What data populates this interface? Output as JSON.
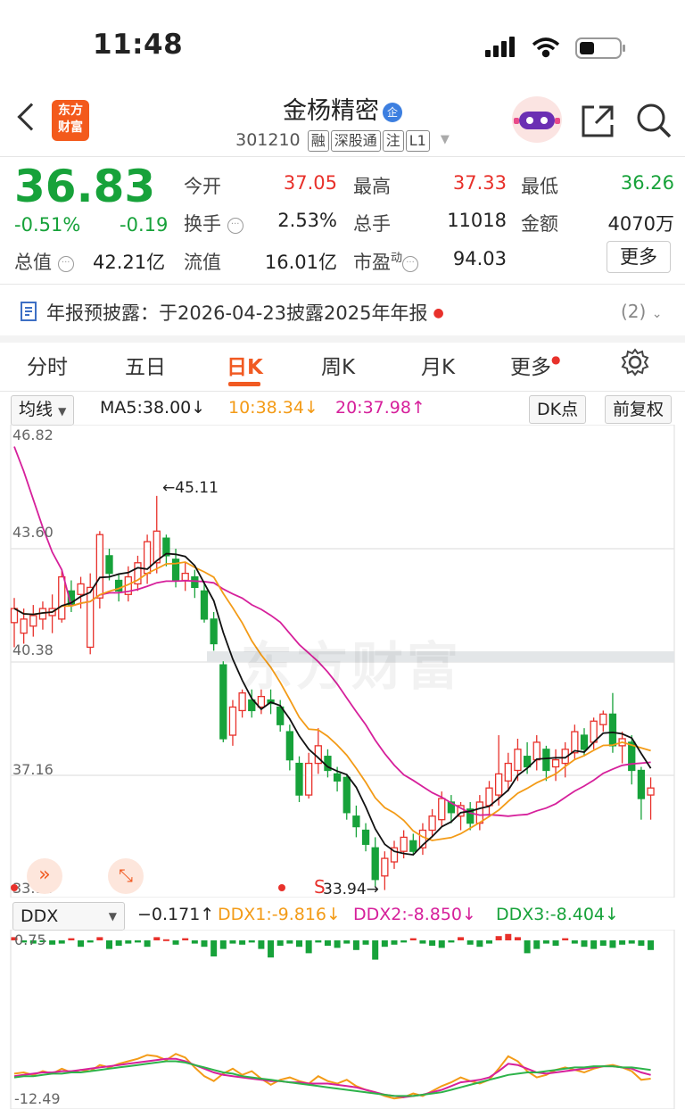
{
  "status": {
    "time": "11:48"
  },
  "header": {
    "logo_line1": "东方",
    "logo_line2": "财富",
    "stock_name": "金杨精密",
    "qi_badge": "企",
    "code": "301210",
    "tags": [
      "融",
      "深股通",
      "注",
      "L1"
    ]
  },
  "quote": {
    "price": "36.83",
    "change_pct": "-0.51%",
    "change": "-0.19",
    "cap_label": "总值",
    "cap_value": "42.21亿",
    "rows": [
      [
        {
          "label": "今开",
          "value": "37.05",
          "color": "red"
        },
        {
          "label": "最高",
          "value": "37.33",
          "color": "red"
        },
        {
          "label": "最低",
          "value": "36.26",
          "color": "green"
        }
      ],
      [
        {
          "label": "换手",
          "value": "2.53%",
          "color": "black"
        },
        {
          "label": "总手",
          "value": "11018",
          "color": "black"
        },
        {
          "label": "金额",
          "value": "4070万",
          "color": "black"
        }
      ],
      [
        {
          "label": "流值",
          "value": "16.01亿",
          "color": "black"
        },
        {
          "label": "市盈",
          "sup": "动",
          "value": "94.03",
          "color": "black"
        }
      ]
    ],
    "more_label": "更多"
  },
  "notice": {
    "text": "年报预披露：于2026-04-23披露2025年年报",
    "count": "(2)"
  },
  "tabs": [
    "分时",
    "五日",
    "日K",
    "周K",
    "月K",
    "更多"
  ],
  "active_tab": "日K",
  "indicators": {
    "ma_select": "均线",
    "ma5": "MA5:38.00",
    "ma10": "10:38.34",
    "ma20": "20:37.98",
    "dk_label": "DK点",
    "adjust_label": "前复权"
  },
  "kchart": {
    "y_labels": [
      "46.82",
      "43.60",
      "40.38",
      "37.16",
      "33.94"
    ],
    "high_label": "45.11",
    "low_label": "33.94",
    "s_marker": "S",
    "watermark": "东方财富"
  },
  "ddx": {
    "select": "DDX",
    "ddx_val": "−0.171",
    "ddx1": "DDX1:-9.816",
    "ddx2": "DDX2:-8.850",
    "ddx3": "DDX3:-8.404",
    "y_top": "0.75",
    "y_bottom": "-12.49"
  },
  "colors": {
    "up": "#e8312b",
    "down": "#17a23a",
    "accent": "#f15a22",
    "ma5": "#111111",
    "ma10": "#f39b17",
    "ma20": "#d6209b"
  },
  "candles": [
    [
      41.5,
      41.9,
      40.8,
      42.2
    ],
    [
      41.2,
      41.6,
      40.9,
      41.9
    ],
    [
      41.4,
      41.7,
      41.1,
      42.0
    ],
    [
      41.6,
      41.9,
      41.3,
      42.1
    ],
    [
      41.7,
      41.9,
      41.2,
      42.3
    ],
    [
      41.6,
      42.8,
      41.5,
      43.0
    ],
    [
      42.4,
      42.0,
      41.8,
      42.7
    ],
    [
      42.3,
      42.6,
      41.9,
      42.8
    ],
    [
      40.8,
      42.5,
      40.6,
      42.9
    ],
    [
      42.2,
      44.0,
      41.9,
      44.1
    ],
    [
      43.4,
      42.9,
      42.7,
      43.6
    ],
    [
      42.7,
      42.4,
      42.1,
      42.9
    ],
    [
      42.3,
      42.8,
      42.1,
      43.1
    ],
    [
      42.6,
      43.2,
      42.4,
      43.4
    ],
    [
      42.9,
      43.8,
      42.6,
      44.0
    ],
    [
      43.2,
      44.1,
      42.9,
      45.1
    ],
    [
      43.9,
      43.4,
      43.1,
      44.0
    ],
    [
      43.3,
      42.7,
      42.5,
      43.6
    ],
    [
      42.7,
      42.9,
      42.4,
      43.2
    ],
    [
      42.8,
      42.5,
      42.2,
      43.0
    ],
    [
      42.4,
      41.6,
      41.5,
      42.6
    ],
    [
      41.6,
      40.9,
      40.7,
      41.8
    ],
    [
      40.3,
      38.2,
      38.1,
      40.4
    ],
    [
      38.3,
      39.1,
      38.0,
      39.3
    ],
    [
      39.0,
      39.5,
      38.8,
      39.6
    ],
    [
      39.3,
      39.0,
      38.8,
      39.6
    ],
    [
      39.1,
      39.4,
      38.9,
      39.6
    ],
    [
      39.3,
      39.2,
      38.9,
      39.6
    ],
    [
      39.1,
      38.6,
      38.4,
      39.3
    ],
    [
      38.4,
      37.6,
      37.3,
      38.6
    ],
    [
      37.5,
      36.6,
      36.4,
      37.7
    ],
    [
      36.6,
      37.5,
      36.5,
      37.8
    ],
    [
      37.5,
      38.0,
      37.2,
      38.5
    ],
    [
      37.7,
      37.3,
      37.1,
      37.9
    ],
    [
      37.2,
      37.0,
      36.7,
      37.4
    ],
    [
      37.1,
      36.1,
      35.9,
      37.2
    ],
    [
      36.0,
      35.7,
      35.4,
      36.3
    ],
    [
      35.6,
      35.2,
      35.0,
      35.8
    ],
    [
      35.1,
      34.2,
      34.0,
      35.4
    ],
    [
      34.3,
      34.8,
      33.9,
      35.0
    ],
    [
      34.7,
      35.1,
      34.5,
      35.3
    ],
    [
      35.0,
      35.4,
      34.8,
      35.6
    ],
    [
      35.3,
      35.0,
      34.9,
      35.5
    ],
    [
      35.1,
      35.6,
      34.9,
      35.8
    ],
    [
      35.6,
      36.0,
      35.4,
      36.2
    ],
    [
      35.9,
      36.5,
      35.7,
      36.7
    ],
    [
      36.4,
      36.1,
      35.8,
      36.6
    ],
    [
      36.0,
      36.3,
      35.6,
      36.4
    ],
    [
      36.2,
      35.8,
      35.6,
      36.4
    ],
    [
      35.8,
      36.4,
      35.6,
      36.6
    ],
    [
      36.3,
      36.8,
      36.0,
      37.0
    ],
    [
      36.6,
      37.2,
      36.3,
      38.3
    ],
    [
      37.0,
      37.5,
      36.7,
      37.8
    ],
    [
      37.3,
      37.9,
      37.0,
      38.2
    ],
    [
      37.7,
      37.4,
      37.2,
      38.1
    ],
    [
      37.6,
      38.1,
      37.3,
      38.3
    ],
    [
      37.9,
      37.3,
      37.0,
      38.0
    ],
    [
      37.4,
      37.6,
      37.0,
      37.9
    ],
    [
      37.5,
      37.9,
      37.1,
      38.1
    ],
    [
      37.8,
      38.4,
      37.6,
      38.6
    ],
    [
      38.3,
      37.9,
      37.7,
      38.5
    ],
    [
      38.1,
      38.7,
      37.9,
      38.8
    ],
    [
      38.6,
      38.9,
      38.4,
      39.0
    ],
    [
      38.9,
      38.0,
      37.8,
      39.5
    ],
    [
      38.0,
      38.2,
      37.5,
      38.4
    ],
    [
      38.1,
      37.3,
      36.9,
      38.3
    ],
    [
      37.3,
      36.5,
      35.9,
      37.4
    ],
    [
      36.6,
      36.8,
      35.9,
      37.1
    ]
  ],
  "chart_data": {
    "type": "candlestick",
    "ylim": [
      33.94,
      46.82
    ],
    "y_ticks": [
      46.82,
      43.6,
      40.38,
      37.16,
      33.94
    ],
    "annotations": {
      "high": 45.11,
      "low": 33.94
    },
    "series": [
      {
        "name": "MA5",
        "last": 38.0
      },
      {
        "name": "MA10",
        "last": 38.34
      },
      {
        "name": "MA20",
        "last": 37.98
      }
    ]
  },
  "ddx_bars": [
    0.3,
    -0.2,
    -0.3,
    -0.1,
    -0.4,
    -0.3,
    0.2,
    -0.6,
    -0.2,
    0.3,
    -0.8,
    -0.5,
    -0.3,
    -0.2,
    -0.6,
    0.3,
    0.1,
    -0.4,
    0.2,
    -0.3,
    -0.6,
    -1.5,
    -0.8,
    -0.3,
    -0.4,
    -0.2,
    -0.8,
    -1.6,
    -0.5,
    -0.3,
    -0.6,
    -1.2,
    -0.2,
    -0.5,
    -0.7,
    -0.3,
    -0.9,
    -0.4,
    -1.8,
    -0.6,
    -0.4,
    -0.2,
    0.2,
    -0.3,
    -0.5,
    -0.7,
    -0.2,
    0.3,
    -0.4,
    -0.6,
    -0.3,
    0.4,
    0.6,
    0.3,
    -1.2,
    -0.8,
    -0.3,
    -0.5,
    0.2,
    -0.3,
    -0.6,
    -0.8,
    -0.5,
    -0.7,
    -0.4,
    -0.3,
    -0.5,
    -0.9
  ],
  "ddx_lines": {
    "ddx1": [
      -10.0,
      -9.9,
      -10.1,
      -9.8,
      -10.0,
      -9.6,
      -9.9,
      -9.7,
      -9.8,
      -9.3,
      -9.5,
      -9.2,
      -9.0,
      -8.8,
      -8.5,
      -8.6,
      -8.9,
      -8.4,
      -8.7,
      -9.5,
      -10.2,
      -10.6,
      -10.0,
      -9.6,
      -10.1,
      -9.8,
      -10.4,
      -10.9,
      -10.5,
      -10.3,
      -10.6,
      -10.8,
      -10.2,
      -10.6,
      -10.8,
      -10.5,
      -11.0,
      -11.3,
      -11.5,
      -11.8,
      -12.0,
      -11.9,
      -11.6,
      -11.8,
      -11.4,
      -11.0,
      -10.7,
      -10.3,
      -10.6,
      -10.8,
      -10.5,
      -9.6,
      -8.6,
      -9.0,
      -9.8,
      -10.3,
      -10.1,
      -9.7,
      -9.5,
      -9.7,
      -9.9,
      -9.6,
      -9.4,
      -9.3,
      -9.5,
      -9.8,
      -10.5,
      -10.4
    ],
    "ddx2": [
      -10.2,
      -10.1,
      -10.0,
      -9.9,
      -9.9,
      -9.8,
      -9.8,
      -9.7,
      -9.6,
      -9.5,
      -9.4,
      -9.3,
      -9.2,
      -9.1,
      -9.0,
      -8.9,
      -8.8,
      -8.8,
      -9.0,
      -9.3,
      -9.6,
      -9.9,
      -10.1,
      -10.2,
      -10.3,
      -10.4,
      -10.5,
      -10.6,
      -10.6,
      -10.7,
      -10.7,
      -10.8,
      -10.8,
      -10.8,
      -10.9,
      -11.0,
      -11.1,
      -11.3,
      -11.5,
      -11.7,
      -11.8,
      -11.9,
      -11.8,
      -11.7,
      -11.5,
      -11.3,
      -11.0,
      -10.7,
      -10.6,
      -10.5,
      -10.3,
      -9.8,
      -9.2,
      -9.3,
      -9.6,
      -9.9,
      -10.0,
      -9.9,
      -9.8,
      -9.7,
      -9.6,
      -9.5,
      -9.4,
      -9.4,
      -9.5,
      -9.6,
      -9.9,
      -10.1
    ],
    "ddx3": [
      -10.3,
      -10.2,
      -10.2,
      -10.1,
      -10.0,
      -10.0,
      -9.9,
      -9.9,
      -9.8,
      -9.7,
      -9.6,
      -9.5,
      -9.4,
      -9.3,
      -9.2,
      -9.1,
      -9.0,
      -9.0,
      -9.1,
      -9.3,
      -9.5,
      -9.7,
      -9.9,
      -10.0,
      -10.2,
      -10.3,
      -10.4,
      -10.5,
      -10.6,
      -10.7,
      -10.8,
      -10.9,
      -11.0,
      -11.1,
      -11.2,
      -11.3,
      -11.4,
      -11.5,
      -11.6,
      -11.7,
      -11.8,
      -11.8,
      -11.8,
      -11.7,
      -11.6,
      -11.5,
      -11.3,
      -11.1,
      -10.9,
      -10.7,
      -10.5,
      -10.3,
      -10.1,
      -10.0,
      -9.9,
      -9.9,
      -9.8,
      -9.7,
      -9.6,
      -9.5,
      -9.5,
      -9.4,
      -9.4,
      -9.4,
      -9.5,
      -9.5,
      -9.6,
      -9.7
    ]
  }
}
